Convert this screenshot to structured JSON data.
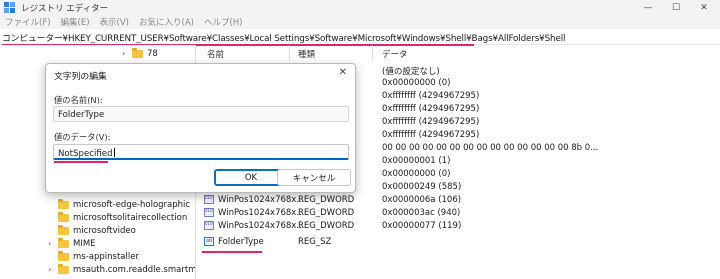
{
  "window": {
    "title": "レジストリ エディター",
    "controls": {
      "minimize": "—",
      "maximize": "☐",
      "close": "✕"
    }
  },
  "menu": [
    "ファイル(F)",
    "編集(E)",
    "表示(V)",
    "お気に入り(A)",
    "ヘルプ(H)"
  ],
  "address": "コンピューター¥HKEY_CURRENT_USER¥Software¥Classes¥Local Settings¥Software¥Microsoft¥Windows¥Shell¥Bags¥AllFolders¥Shell",
  "tree": {
    "items": [
      {
        "label": "78",
        "expandable": true
      },
      {
        "label": "microsoft-edge-holographic",
        "expandable": false
      },
      {
        "label": "microsoftsolitairecollection",
        "expandable": false
      },
      {
        "label": "microsoftvideo",
        "expandable": false
      },
      {
        "label": "MIME",
        "expandable": true
      },
      {
        "label": "ms-appinstaller",
        "expandable": false
      },
      {
        "label": "msauth.com.readdle.smartma",
        "expandable": true
      }
    ]
  },
  "values": {
    "columns": {
      "name": "名前",
      "type": "種類",
      "data": "データ"
    },
    "rows": [
      {
        "name": "",
        "type": "",
        "data": "(値の設定なし)",
        "icon": ""
      },
      {
        "name": "",
        "type": "",
        "data": "0x00000000 (0)",
        "icon": ""
      },
      {
        "name": "",
        "type": "",
        "data": "0xffffffff (4294967295)",
        "icon": ""
      },
      {
        "name": "",
        "type": "",
        "data": "0xffffffff (4294967295)",
        "icon": ""
      },
      {
        "name": "",
        "type": "",
        "data": "0xffffffff (4294967295)",
        "icon": ""
      },
      {
        "name": "",
        "type": "",
        "data": "0xffffffff (4294967295)",
        "icon": ""
      },
      {
        "name": "",
        "type": "",
        "data": "00 00 00 00 00 00 00 00 00 00 00 00 00 00 8b 0...",
        "icon": ""
      },
      {
        "name": "",
        "type": "",
        "data": "0x00000001 (1)",
        "icon": ""
      },
      {
        "name": "",
        "type": "",
        "data": "0x00000000 (0)",
        "icon": ""
      },
      {
        "name": "",
        "type": "",
        "data": "0x00000249 (585)",
        "icon": ""
      },
      {
        "name": "WinPos1024x768x...",
        "type": "REG_DWORD",
        "data": "0x0000006a (106)",
        "icon": "dword"
      },
      {
        "name": "WinPos1024x768x...",
        "type": "REG_DWORD",
        "data": "0x000003ac (940)",
        "icon": "dword"
      },
      {
        "name": "WinPos1024x768x...",
        "type": "REG_DWORD",
        "data": "0x00000077 (119)",
        "icon": "dword"
      },
      {
        "name": "FolderType",
        "type": "REG_SZ",
        "data": "",
        "icon": "string"
      }
    ]
  },
  "dialog": {
    "title": "文字列の編集",
    "close": "✕",
    "name_label": "値の名前(N):",
    "name_value": "FolderType",
    "data_label": "値のデータ(V):",
    "data_value": "NotSpecified",
    "ok": "OK",
    "cancel": "キャンセル"
  },
  "colors": {
    "highlight": "#e0236c",
    "accent": "#0067c0"
  }
}
